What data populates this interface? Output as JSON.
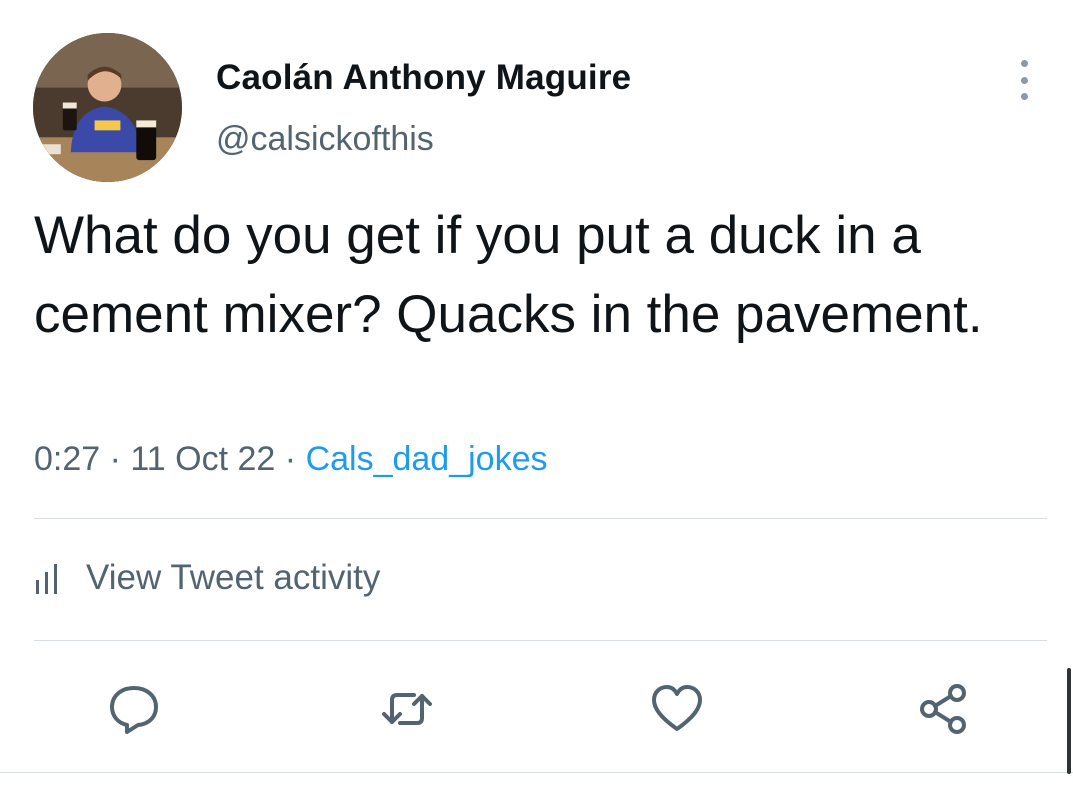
{
  "tweet": {
    "author_name": "Caolán Anthony Maguire",
    "handle": "@calsickofthis",
    "text": "What do you get if you put a duck in a cement mixer? Quacks in the pavement.",
    "time": "0:27",
    "separator": "·",
    "date": "11 Oct 22",
    "source": "Cals_dad_jokes"
  },
  "activity": {
    "label": "View Tweet activity",
    "icon": "bar-chart-icon"
  },
  "actions": [
    {
      "name": "reply",
      "icon": "reply-icon"
    },
    {
      "name": "retweet",
      "icon": "retweet-icon"
    },
    {
      "name": "like",
      "icon": "heart-icon"
    },
    {
      "name": "share",
      "icon": "share-icon"
    }
  ],
  "colors": {
    "text": "#0f1419",
    "secondary": "#536471",
    "link": "#1d9bf0",
    "divider": "#d9dee2"
  }
}
